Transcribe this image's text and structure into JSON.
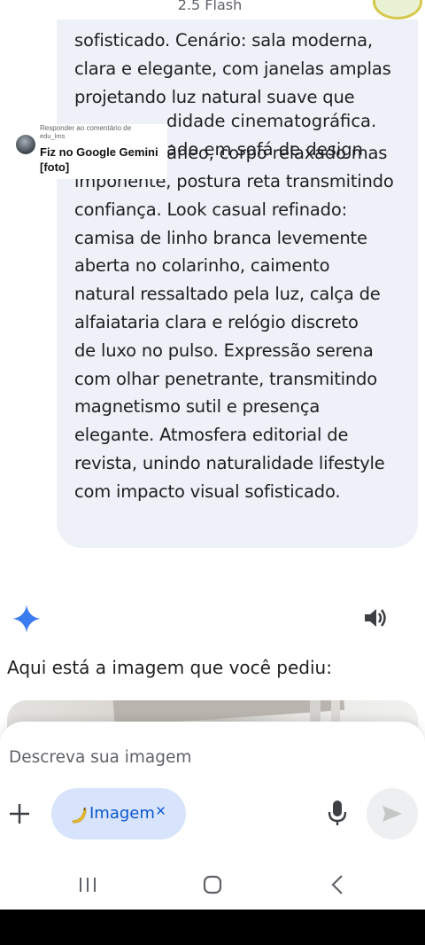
{
  "header": {
    "model_label": "2.5 Flash",
    "avatar_icon": "profile-avatar-icon"
  },
  "prompt_bubble": {
    "text": "sofisticado. Cenário: sala moderna,\nclara e elegante, com janelas amplas\nprojetando luz natural suave que\n\ncontemporâneo, corpo relaxado mas\nimponente, postura reta transmitindo\nconfiança. Look casual refinado:\ncamisa de linho branca levemente\naberta no colarinho, caimento\nnatural ressaltado pela luz, calça de\nalfaiataria clara e relógio discreto\nde luxo no pulso. Expressão serena\ncom olhar penetrante, transmitindo\nmagnetismo sutil e presença\nelegante. Atmosfera editorial de\nrevista, unindo naturalidade lifestyle\ncom impacto visual sofisticado.",
    "partial_line_1": "didade cinematográfica.",
    "partial_line_2": "ado em sofá de design"
  },
  "reply_overlay": {
    "heading": "Responder ao comentário de",
    "username": "edu_lms",
    "message": "Fiz no Google Gemini [foto]"
  },
  "response": {
    "icon": "gemini-sparkle-icon",
    "speaker_icon": "speaker-icon",
    "text": "Aqui está a imagem que você pediu:"
  },
  "composer": {
    "placeholder": "Descreva sua imagem",
    "chip_label": "Imagem",
    "chip_close": "×",
    "chip_icon": "banana-icon",
    "plus_icon": "plus-icon",
    "mic_icon": "microphone-icon",
    "send_icon": "send-icon"
  },
  "navbar": {
    "recents_icon": "recents-icon",
    "home_icon": "home-icon",
    "back_icon": "back-icon"
  },
  "colors": {
    "bubble_bg": "#eef1f8",
    "chip_bg": "#d8e4fb",
    "accent": "#0b57d0",
    "sparkle": "#3b7bf0"
  }
}
